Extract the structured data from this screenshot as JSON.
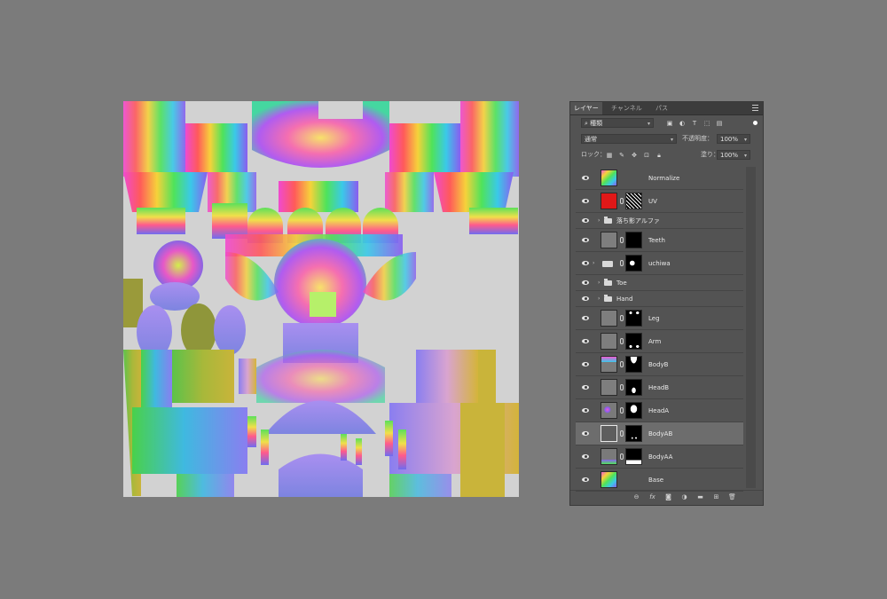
{
  "panel": {
    "tabs": [
      "レイヤー",
      "チャンネル",
      "パス"
    ],
    "active_tab": 0,
    "filter": {
      "label": "種類",
      "icons": [
        "image-filter-icon",
        "adjustment-filter-icon",
        "type-filter-icon",
        "shape-filter-icon",
        "smart-object-filter-icon"
      ]
    },
    "blend_mode": "通常",
    "opacity_label": "不透明度：",
    "opacity_value": "100%",
    "lock_label": "ロック：",
    "fill_label": "塗り：",
    "fill_value": "100%"
  },
  "layers": [
    {
      "name": "Normalize",
      "kind": "layer",
      "thumb": "texture",
      "mask": false,
      "selected": false
    },
    {
      "name": "UV",
      "kind": "layer",
      "thumb": "red",
      "mask": "noise",
      "selected": false
    },
    {
      "name": "落ち影アルファ",
      "kind": "group",
      "selected": false
    },
    {
      "name": "Teeth",
      "kind": "layer",
      "thumb": "gray",
      "mask": "black",
      "selected": false
    },
    {
      "name": "uchiwa",
      "kind": "group-mask",
      "thumb": "folder",
      "mask": "spot",
      "selected": false
    },
    {
      "name": "Toe",
      "kind": "group",
      "selected": false
    },
    {
      "name": "Hand",
      "kind": "group",
      "selected": false
    },
    {
      "name": "Leg",
      "kind": "layer",
      "thumb": "gray",
      "mask": "dots-top",
      "selected": false
    },
    {
      "name": "Arm",
      "kind": "layer",
      "thumb": "gray",
      "mask": "dots-bottom",
      "selected": false
    },
    {
      "name": "BodyB",
      "kind": "layer",
      "thumb": "texture-top",
      "mask": "bumps",
      "selected": false
    },
    {
      "name": "HeadB",
      "kind": "layer",
      "thumb": "gray",
      "mask": "blob",
      "selected": false
    },
    {
      "name": "HeadA",
      "kind": "layer",
      "thumb": "texture-small",
      "mask": "figure",
      "selected": false
    },
    {
      "name": "BodyAB",
      "kind": "layer",
      "thumb": "gray-dark",
      "mask": "specks",
      "selected": true
    },
    {
      "name": "BodyAA",
      "kind": "layer",
      "thumb": "texture-bottom",
      "mask": "bottom-shapes",
      "selected": false
    },
    {
      "name": "Base",
      "kind": "layer",
      "thumb": "texture",
      "mask": false,
      "selected": false
    }
  ],
  "bottom_icons": [
    "link-layers-icon",
    "fx-icon",
    "add-mask-icon",
    "adjustment-layer-icon",
    "new-group-icon",
    "new-layer-icon",
    "delete-layer-icon"
  ]
}
